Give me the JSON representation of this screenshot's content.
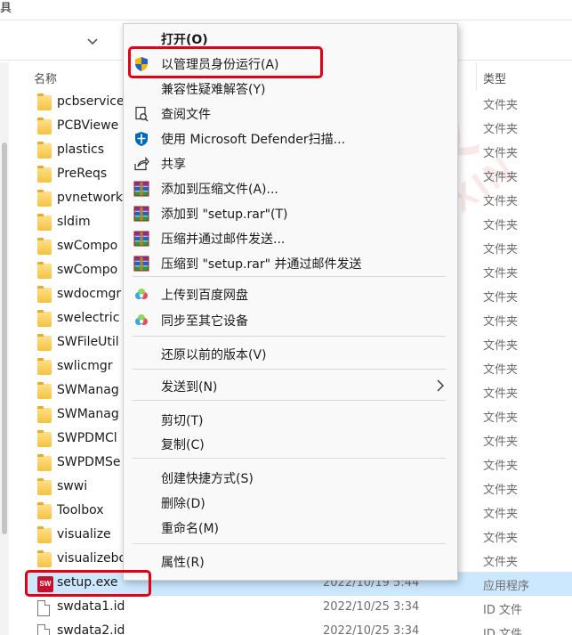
{
  "window": {
    "title_fragment": "具"
  },
  "columns": {
    "name": "名称",
    "type": "类型"
  },
  "files": [
    {
      "name": "pcbservice",
      "type": "文件夹",
      "kind": "folder"
    },
    {
      "name": "PCBViewe",
      "type": "文件夹",
      "kind": "folder"
    },
    {
      "name": "plastics",
      "type": "文件夹",
      "kind": "folder"
    },
    {
      "name": "PreReqs",
      "type": "文件夹",
      "kind": "folder"
    },
    {
      "name": "pvnetwork",
      "type": "文件夹",
      "kind": "folder"
    },
    {
      "name": "sldim",
      "type": "文件夹",
      "kind": "folder"
    },
    {
      "name": "swCompo",
      "type": "文件夹",
      "kind": "folder"
    },
    {
      "name": "swCompo",
      "type": "文件夹",
      "kind": "folder"
    },
    {
      "name": "swdocmgr",
      "type": "文件夹",
      "kind": "folder"
    },
    {
      "name": "swelectric",
      "type": "文件夹",
      "kind": "folder"
    },
    {
      "name": "SWFileUtil",
      "type": "文件夹",
      "kind": "folder"
    },
    {
      "name": "swlicmgr",
      "type": "文件夹",
      "kind": "folder"
    },
    {
      "name": "SWManag",
      "type": "文件夹",
      "kind": "folder"
    },
    {
      "name": "SWManag",
      "type": "文件夹",
      "kind": "folder"
    },
    {
      "name": "SWPDMCl",
      "type": "文件夹",
      "kind": "folder"
    },
    {
      "name": "SWPDMSe",
      "type": "文件夹",
      "kind": "folder"
    },
    {
      "name": "swwi",
      "type": "文件夹",
      "kind": "folder"
    },
    {
      "name": "Toolbox",
      "type": "文件夹",
      "kind": "folder"
    },
    {
      "name": "visualize",
      "type": "文件夹",
      "kind": "folder"
    },
    {
      "name": "visualizebo",
      "type": "文件夹",
      "kind": "folder"
    },
    {
      "name": "setup.exe",
      "date": "2022/10/19 5:44",
      "type": "应用程序",
      "kind": "exe",
      "selected": true
    },
    {
      "name": "swdata1.id",
      "date": "2022/10/25 3:34",
      "type": "ID 文件",
      "kind": "doc"
    },
    {
      "name": "swdata2.id",
      "date": "2022/10/25 3:34",
      "type": "ID 文件",
      "kind": "doc"
    }
  ],
  "context_menu": {
    "items": [
      {
        "label": "打开(O)",
        "icon": "none",
        "bold": true
      },
      {
        "label": "以管理员身份运行(A)",
        "icon": "uac-shield-icon"
      },
      {
        "label": "兼容性疑难解答(Y)",
        "icon": "none"
      },
      {
        "label": "查阅文件",
        "icon": "view-file-icon"
      },
      {
        "label": "使用 Microsoft Defender扫描...",
        "icon": "defender-shield-icon"
      },
      {
        "label": "共享",
        "icon": "share-icon"
      },
      {
        "label": "添加到压缩文件(A)...",
        "icon": "winrar-icon"
      },
      {
        "label": "添加到 \"setup.rar\"(T)",
        "icon": "winrar-icon"
      },
      {
        "label": "压缩并通过邮件发送...",
        "icon": "winrar-icon"
      },
      {
        "label": "压缩到 \"setup.rar\" 并通过邮件发送",
        "icon": "winrar-icon"
      },
      {
        "label": "上传到百度网盘",
        "icon": "baidu-cloud-icon"
      },
      {
        "label": "同步至其它设备",
        "icon": "baidu-cloud-icon"
      },
      {
        "label": "还原以前的版本(V)",
        "icon": "none"
      },
      {
        "label": "发送到(N)",
        "icon": "none",
        "submenu": true
      },
      {
        "label": "剪切(T)",
        "icon": "none"
      },
      {
        "label": "复制(C)",
        "icon": "none"
      },
      {
        "label": "创建快捷方式(S)",
        "icon": "none"
      },
      {
        "label": "删除(D)",
        "icon": "none"
      },
      {
        "label": "重命名(M)",
        "icon": "none"
      },
      {
        "label": "属性(R)",
        "icon": "none"
      }
    ]
  },
  "watermark": {
    "cn": "信科技",
    "en": "SHENG+XIN"
  },
  "colors": {
    "highlight": "#e60012",
    "selection": "#cce8ff",
    "menu_bg": "#f9f9f9"
  }
}
